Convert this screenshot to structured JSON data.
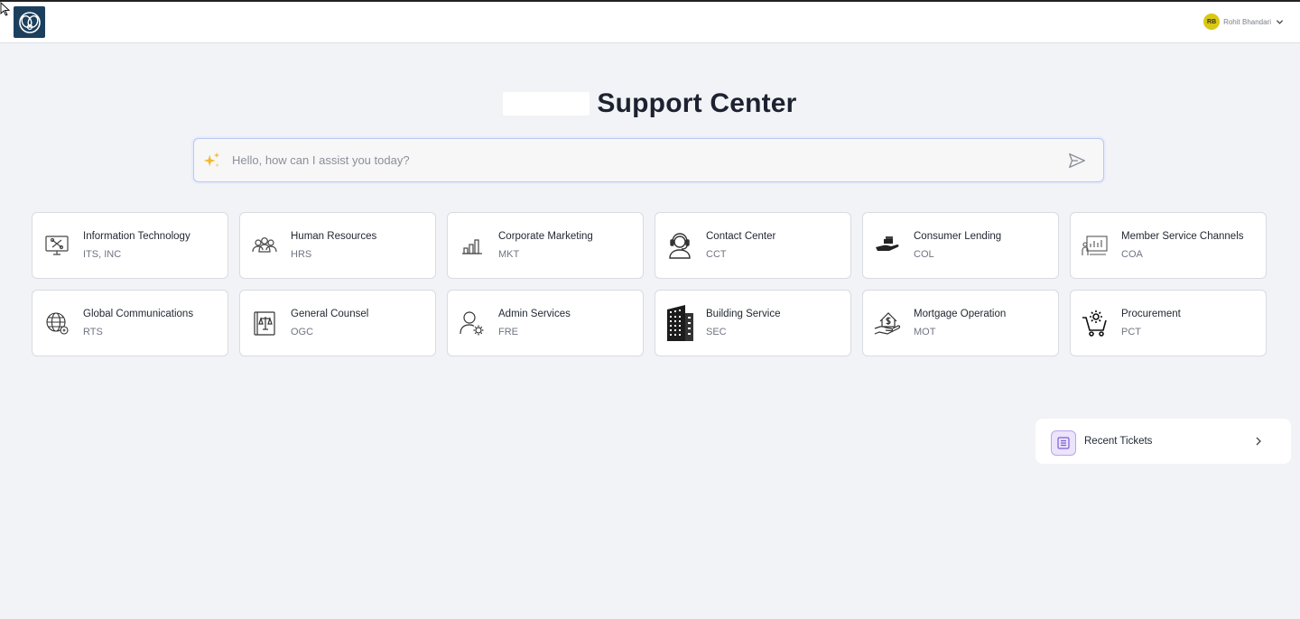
{
  "header": {
    "user": {
      "initials": "RB",
      "name": "Rohit Bhandari"
    }
  },
  "page": {
    "title": "Support Center"
  },
  "search": {
    "placeholder": "Hello, how can I assist you today?",
    "value": ""
  },
  "departments": [
    {
      "name": "Information Technology",
      "code": "ITS, INC",
      "icon": "monitor-tools-icon"
    },
    {
      "name": "Human Resources",
      "code": "HRS",
      "icon": "people-group-icon"
    },
    {
      "name": "Corporate Marketing",
      "code": "MKT",
      "icon": "bar-chart-icon"
    },
    {
      "name": "Contact Center",
      "code": "CCT",
      "icon": "headset-agent-icon"
    },
    {
      "name": "Consumer Lending",
      "code": "COL",
      "icon": "hand-money-icon"
    },
    {
      "name": "Member Service Channels",
      "code": "COA",
      "icon": "presentation-board-icon"
    },
    {
      "name": "Global Communications",
      "code": "RTS",
      "icon": "globe-icon"
    },
    {
      "name": "General Counsel",
      "code": "OGC",
      "icon": "legal-scales-icon"
    },
    {
      "name": "Admin Services",
      "code": "FRE",
      "icon": "user-gear-icon"
    },
    {
      "name": "Building Service",
      "code": "SEC",
      "icon": "office-building-icon"
    },
    {
      "name": "Mortgage Operation",
      "code": "MOT",
      "icon": "house-dollar-icon"
    },
    {
      "name": "Procurement",
      "code": "PCT",
      "icon": "cart-gear-icon"
    }
  ],
  "recent": {
    "label": "Recent Tickets",
    "icon": "ticket-list-icon"
  },
  "colors": {
    "accent": "#1d3f5e",
    "avatar": "#d9c814",
    "recent_icon_bg": "#ece4fb"
  }
}
